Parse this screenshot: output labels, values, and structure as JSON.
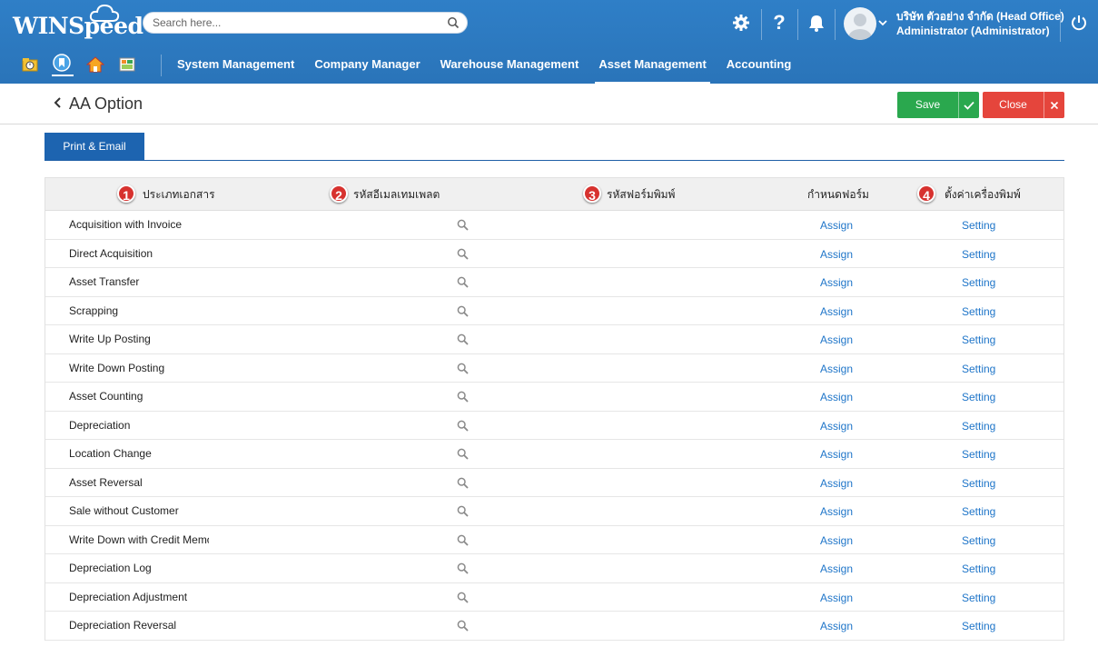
{
  "app": {
    "logo_text": "WINSpeed",
    "search_placeholder": "Search here...",
    "company_line1": "บริษัท ตัวอย่าง จำกัด (Head Office)",
    "company_line2": "Administrator (Administrator)"
  },
  "menu": {
    "items": [
      {
        "label": "System Management",
        "active": false
      },
      {
        "label": "Company Manager",
        "active": false
      },
      {
        "label": "Warehouse Management",
        "active": false
      },
      {
        "label": "Asset Management",
        "active": true
      },
      {
        "label": "Accounting",
        "active": false
      }
    ]
  },
  "page": {
    "title": "AA Option",
    "save_label": "Save",
    "close_label": "Close"
  },
  "tabs": [
    {
      "label": "Print & Email",
      "active": true
    }
  ],
  "table": {
    "headers": {
      "doc_type": "ประเภทเอกสาร",
      "email_template": "รหัสอีเมลเทมเพลต",
      "print_form": "รหัสฟอร์มพิมพ์",
      "assign_form": "กำหนดฟอร์ม",
      "printer_setting": "ตั้งค่าเครื่องพิมพ์"
    },
    "badges": [
      "1",
      "2",
      "3",
      "4"
    ],
    "assign_label": "Assign",
    "setting_label": "Setting",
    "rows": [
      "Acquisition with Invoice",
      "Direct Acquisition",
      "Asset Transfer",
      "Scrapping",
      "Write Up Posting",
      "Write Down Posting",
      "Asset Counting",
      "Depreciation",
      "Location Change",
      "Asset Reversal",
      "Sale without Customer",
      "Write Down with Credit Memo",
      "Depreciation Log",
      "Depreciation Adjustment",
      "Depreciation Reversal"
    ]
  },
  "colors": {
    "header_blue": "#2a74b9",
    "tab_blue": "#1d64b0",
    "save_green": "#2aa84e",
    "close_red": "#e5453c",
    "link_blue": "#2076c9",
    "badge_red": "#d7322f"
  }
}
